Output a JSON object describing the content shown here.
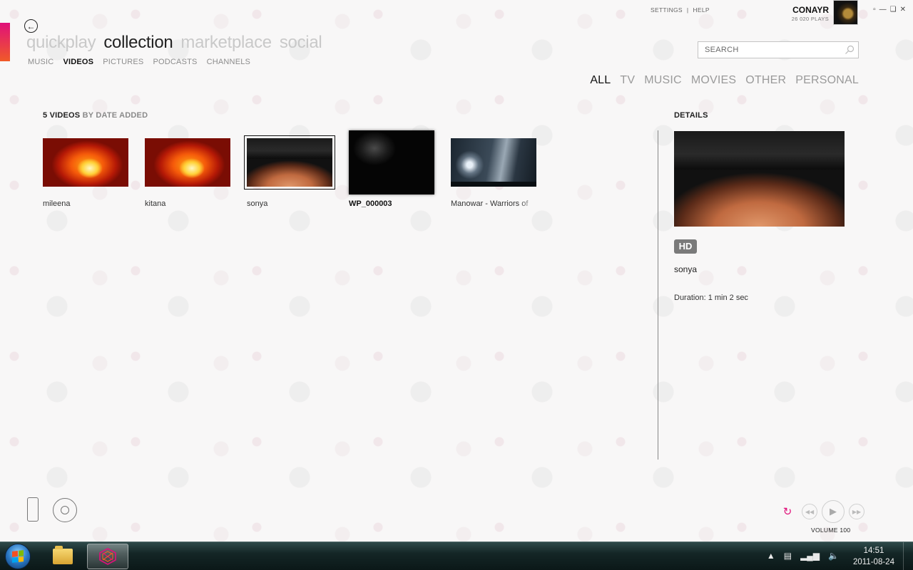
{
  "header": {
    "main_nav": [
      "quickplay",
      "collection",
      "marketplace",
      "social"
    ],
    "active_main": "collection",
    "sub_nav": [
      "MUSIC",
      "VIDEOS",
      "PICTURES",
      "PODCASTS",
      "CHANNELS"
    ],
    "active_sub": "VIDEOS",
    "links": {
      "settings": "SETTINGS",
      "separator": "|",
      "help": "HELP"
    },
    "user": {
      "name": "CONAYR",
      "plays": "26 020 PLAYS"
    }
  },
  "search": {
    "placeholder": "SEARCH"
  },
  "filters": {
    "items": [
      "ALL",
      "TV",
      "MUSIC",
      "MOVIES",
      "OTHER",
      "PERSONAL"
    ],
    "active": "ALL"
  },
  "collection": {
    "count": "5 VIDEOS",
    "sort": "BY DATE ADDED",
    "videos": [
      {
        "label": "mileena",
        "thumb": "fire"
      },
      {
        "label": "kitana",
        "thumb": "fire"
      },
      {
        "label": "sonya",
        "thumb": "belly",
        "selected": true
      },
      {
        "label": "WP_000003",
        "thumb": "dark",
        "hovered": true
      },
      {
        "label": "Manowar - Warriors of",
        "thumb": "manowar"
      }
    ]
  },
  "details": {
    "title": "DETAILS",
    "badge": "HD",
    "name": "sonya",
    "duration": "Duration: 1 min 2 sec"
  },
  "player": {
    "volume_label": "VOLUME 100"
  },
  "taskbar": {
    "time": "14:51",
    "date": "2011-08-24"
  },
  "colors": {
    "accent": "#e0107a",
    "accent2": "#f05a28",
    "taskbar": "#142626"
  }
}
